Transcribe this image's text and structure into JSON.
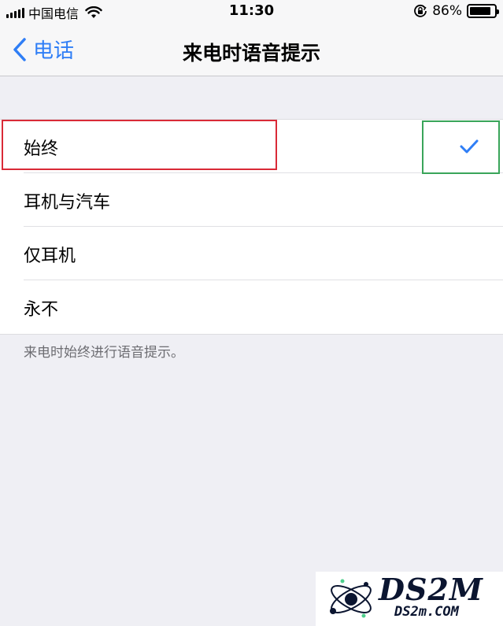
{
  "status_bar": {
    "carrier": "中国电信",
    "time": "11:30",
    "battery_percent": "86%",
    "battery_level": 0.86,
    "icons": [
      "signal-icon",
      "wifi-icon",
      "orientation-lock-icon",
      "battery-icon"
    ]
  },
  "nav": {
    "back_label": "电话",
    "title": "来电时语音提示",
    "accent_color": "#2f7ef6"
  },
  "options": [
    {
      "label": "始终",
      "selected": true
    },
    {
      "label": "耳机与汽车",
      "selected": false
    },
    {
      "label": "仅耳机",
      "selected": false
    },
    {
      "label": "永不",
      "selected": false
    }
  ],
  "footer_note": "来电时始终进行语音提示。",
  "annotations": {
    "red_box_color": "#d92a37",
    "green_box_color": "#3aa55a"
  },
  "watermark": {
    "brand": "DS2M",
    "domain": "DS2m.COM"
  }
}
